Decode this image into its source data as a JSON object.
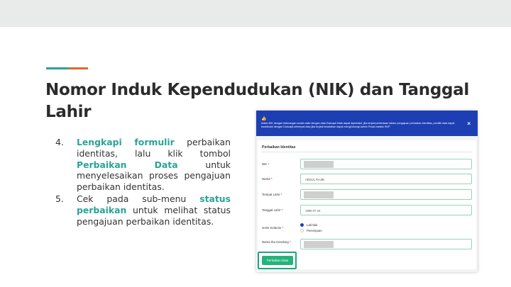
{
  "colors": {
    "accent_teal": "#2aa396",
    "accent_orange": "#e5652a",
    "highlight": "#2aa396",
    "banner_blue": "#1d3fb3",
    "button_green": "#25b37b"
  },
  "title": "Nomor Induk Kependudukan (NIK) dan Tanggal Lahir",
  "steps": [
    {
      "number": "4.",
      "parts": [
        "Lengkapi formulir",
        " perbaikan identitas, lalu klik tombol ",
        "Perbaikan Data",
        " untuk menyelesaikan proses pengajuan perbaikan identitas."
      ]
    },
    {
      "number": "5.",
      "parts": [
        "Cek pada sub-menu ",
        "status perbaikan",
        " untuk melihat status pengajuan perbaikan identitas."
      ]
    }
  ],
  "screenshot": {
    "banner": {
      "icon": "thumbs-up-icon",
      "text": "Isikan NIK dengan keterangan sudah valid dengan data Dukcapil tidak dapat diperbaiki, jika terjadi perbedaan dalam pengajuan perbaikan identitas, pemilik data dapat koordinasi dengan Dukcapil setempat atau jika terjadi kesalahan dapat menghubungi admin Pusat melalui SKP",
      "close": "×"
    },
    "section_title": "Perbaikan Identitas",
    "fields": [
      {
        "label": "NIK",
        "required": "*",
        "value": ""
      },
      {
        "label": "Nama",
        "required": "*",
        "value": "ABDUL RAJIB"
      },
      {
        "label": "Tempat Lahir",
        "required": "*",
        "value": ""
      },
      {
        "label": "Tanggal Lahir",
        "required": "*",
        "value": "1980-07-15"
      }
    ],
    "gender": {
      "label": "Jenis Kelamin",
      "required": "*",
      "options": [
        "Laki-laki",
        "Perempuan"
      ],
      "selected": "Laki-laki"
    },
    "mother": {
      "label": "Nama Ibu Kandung",
      "required": "*",
      "value": ""
    },
    "submit_label": "Perbaikan Data"
  }
}
